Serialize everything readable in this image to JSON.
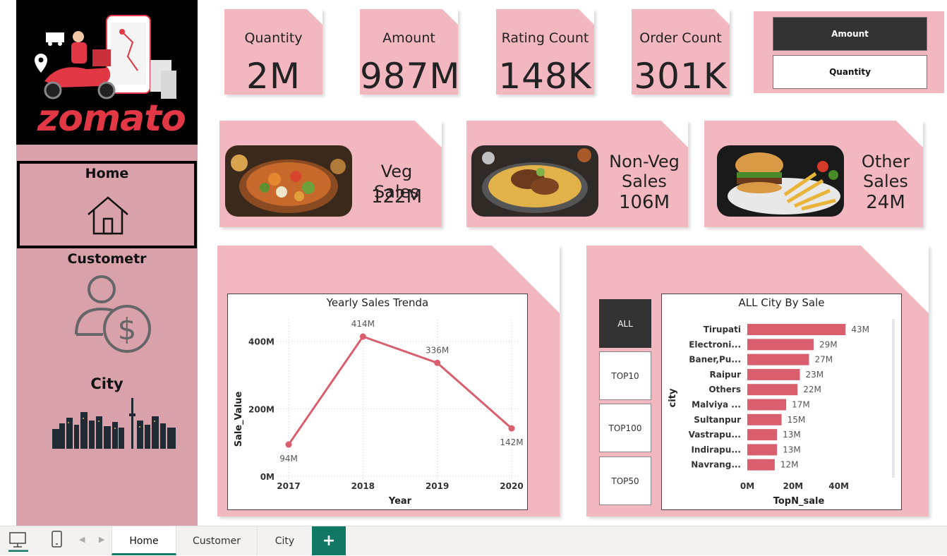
{
  "brand": {
    "logo_text": "zomato"
  },
  "nav": {
    "home": "Home",
    "customer": "Custometr",
    "city": "City"
  },
  "kpis": [
    {
      "label": "Quantity",
      "value": "2M"
    },
    {
      "label": "Amount",
      "value": "987M"
    },
    {
      "label": "Rating Count",
      "value": "148K"
    },
    {
      "label": "Order Count",
      "value": "301K"
    }
  ],
  "measure_slicer": {
    "options": [
      "Amount",
      "Quantity"
    ],
    "selected": "Amount"
  },
  "food_sales": [
    {
      "line1": "Veg Sales",
      "line2": "",
      "value": "122M"
    },
    {
      "line1": "Non-Veg",
      "line2": "Sales",
      "value": "106M"
    },
    {
      "line1": "Other",
      "line2": "Sales",
      "value": "24M"
    }
  ],
  "city_slicer": {
    "options": [
      "ALL",
      "TOP10",
      "TOP100",
      "TOP50"
    ],
    "selected": "ALL"
  },
  "colors": {
    "card": "#f3b7bf",
    "sidebar": "#d9a2aa",
    "series": "#d95f6e",
    "selected": "#333333",
    "accent": "#117865"
  },
  "chart_data": [
    {
      "type": "line",
      "title": "Yearly Sales Trenda",
      "xlabel": "Year",
      "ylabel": "Sale_Value",
      "x": [
        "2017",
        "2018",
        "2019",
        "2020"
      ],
      "values": [
        94,
        414,
        336,
        142
      ],
      "data_labels": [
        "94M",
        "414M",
        "336M",
        "142M"
      ],
      "y_ticks": [
        "0M",
        "200M",
        "400M"
      ],
      "ylim": [
        0,
        460
      ],
      "grid": true
    },
    {
      "type": "bar",
      "orientation": "horizontal",
      "title": "ALL City By Sale",
      "xlabel": "TopN_sale",
      "ylabel": "city",
      "categories": [
        "Tirupati",
        "Electroni...",
        "Baner,Pu...",
        "Raipur",
        "Others",
        "Malviya ...",
        "Sultanpur",
        "Vastrapu...",
        "Indirapu...",
        "Navrang..."
      ],
      "values": [
        43,
        29,
        27,
        23,
        22,
        17,
        15,
        13,
        13,
        12
      ],
      "data_labels": [
        "43M",
        "29M",
        "27M",
        "23M",
        "22M",
        "17M",
        "15M",
        "13M",
        "13M",
        "12M"
      ],
      "x_ticks": [
        "0M",
        "20M",
        "40M"
      ],
      "xlim": [
        0,
        50
      ],
      "grid": false
    }
  ],
  "tabs": {
    "home": "Home",
    "customer": "Customer",
    "city": "City",
    "add": "+"
  }
}
